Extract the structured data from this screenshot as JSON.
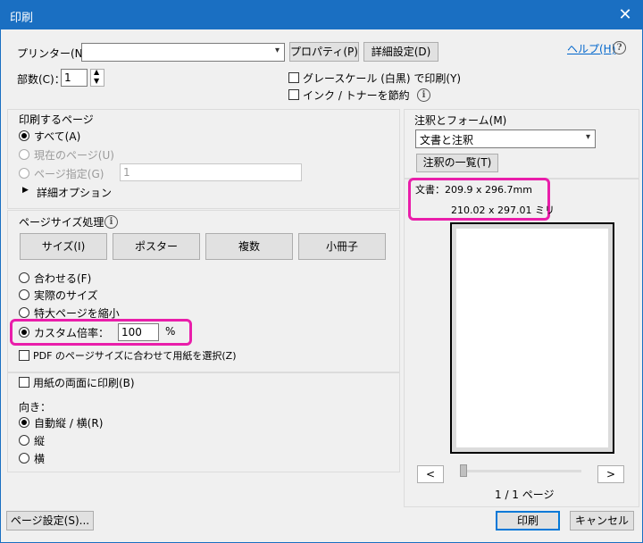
{
  "window": {
    "title": "印刷"
  },
  "printer": {
    "label": "プリンター(N)：",
    "value": "",
    "properties_btn": "プロパティ(P)",
    "advanced_btn": "詳細設定(D)",
    "help_link": "ヘルプ(H)"
  },
  "copies": {
    "label": "部数(C)：",
    "value": "1"
  },
  "options": {
    "grayscale": "グレースケール (白黒) で印刷(Y)",
    "save_ink": "インク / トナーを節約"
  },
  "pages_section": {
    "title": "印刷するページ",
    "all": "すべて(A)",
    "current": "現在のページ(U)",
    "range": "ページ指定(G)",
    "range_value": "1",
    "more_options": "詳細オプション"
  },
  "size_section": {
    "title": "ページサイズ処理",
    "tabs": [
      "サイズ(I)",
      "ポスター",
      "複数",
      "小冊子"
    ],
    "fit": "合わせる(F)",
    "actual": "実際のサイズ",
    "shrink": "特大ページを縮小",
    "custom": "カスタム倍率：",
    "custom_value": "100",
    "custom_unit": "%",
    "choose_paper": "PDF のページサイズに合わせて用紙を選択(Z)"
  },
  "duplex": {
    "label": "用紙の両面に印刷(B)"
  },
  "orientation": {
    "title": "向き：",
    "auto": "自動縦 / 横(R)",
    "portrait": "縦",
    "landscape": "横"
  },
  "comments": {
    "title": "注釈とフォーム(M)",
    "value": "文書と注釈",
    "summary_btn": "注釈の一覧(T)"
  },
  "preview": {
    "doc_size": "文書：209.9 x 296.7mm",
    "paper_size": "210.02 x 297.01 ミリ",
    "prev": "<",
    "next": ">",
    "page_count": "1 / 1 ページ"
  },
  "footer": {
    "page_setup": "ページ設定(S)...",
    "print": "印刷",
    "cancel": "キャンセル"
  },
  "colors": {
    "titlebar": "#1a6fc2",
    "highlight": "#e91eaa",
    "link": "#0066cc"
  }
}
